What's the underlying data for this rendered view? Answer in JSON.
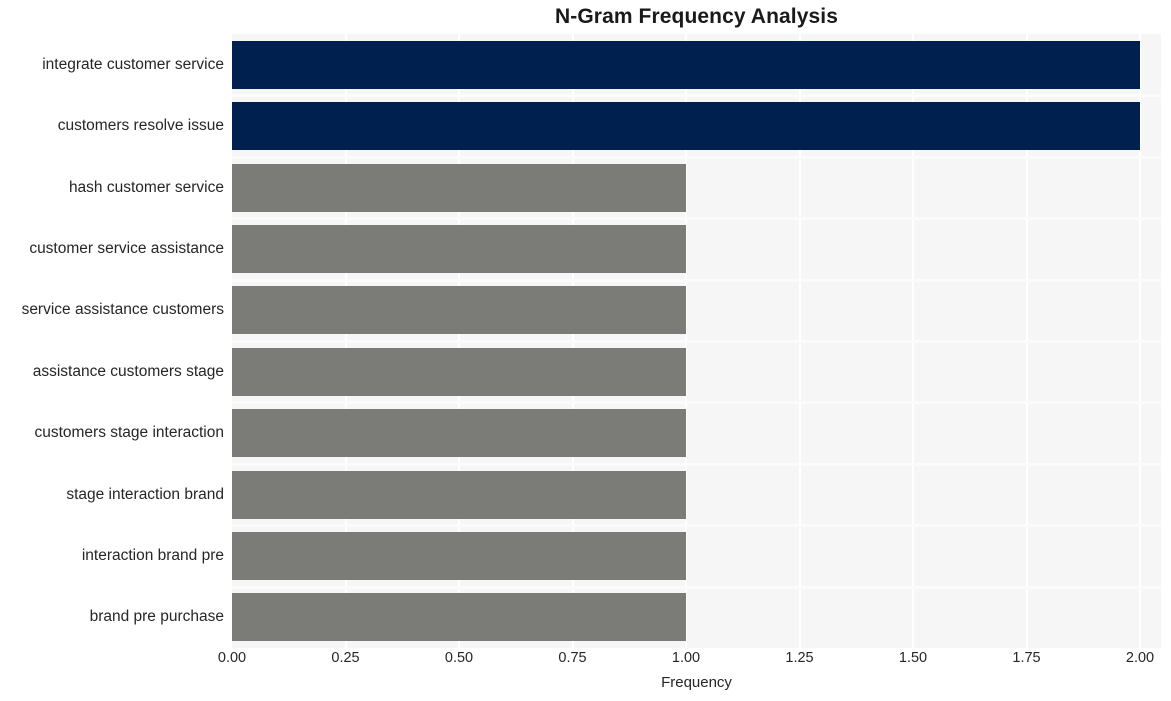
{
  "chart_data": {
    "type": "bar",
    "orientation": "horizontal",
    "title": "N-Gram Frequency Analysis",
    "xlabel": "Frequency",
    "ylabel": "",
    "categories": [
      "integrate customer service",
      "customers resolve issue",
      "hash customer service",
      "customer service assistance",
      "service assistance customers",
      "assistance customers stage",
      "customers stage interaction",
      "stage interaction brand",
      "interaction brand pre",
      "brand pre purchase"
    ],
    "values": [
      2,
      2,
      1,
      1,
      1,
      1,
      1,
      1,
      1,
      1
    ],
    "bar_colors": [
      "#002050",
      "#002050",
      "#7b7b78",
      "#7b7b78",
      "#7b7b78",
      "#7b7b78",
      "#7b7b78",
      "#7b7b78",
      "#7b7b78",
      "#7b7b78"
    ],
    "xlim": [
      0,
      2
    ],
    "xticks": [
      0,
      0.25,
      0.5,
      0.75,
      1,
      1.25,
      1.5,
      1.75,
      2
    ],
    "xticklabels": [
      "0.00",
      "0.25",
      "0.50",
      "0.75",
      "1.00",
      "1.25",
      "1.50",
      "1.75",
      "2.00"
    ],
    "grid": true,
    "grid_axis": "x",
    "grid_color": "#ffffff",
    "legend": null,
    "plot_background": "#f6f6f7",
    "figure_background": "#ffffff",
    "highlight_color": "#002050",
    "base_color": "#7b7b78"
  }
}
